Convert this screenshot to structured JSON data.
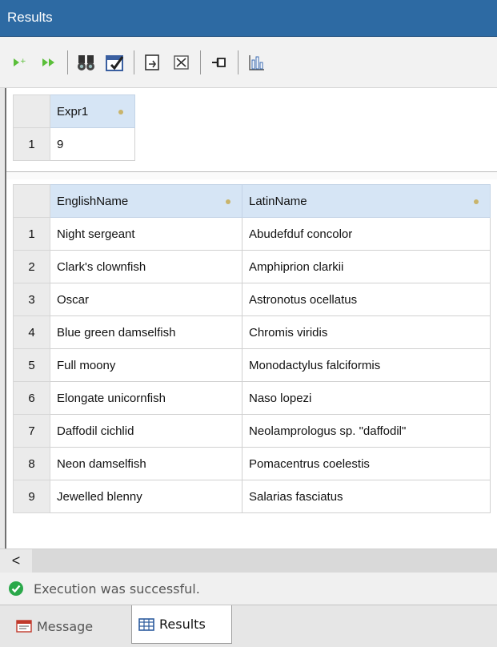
{
  "window": {
    "title": "Results"
  },
  "toolbar": {
    "icons": [
      "step-into-icon",
      "run-icon",
      "binoculars-find-icon",
      "checklist-icon",
      "export-icon",
      "fit-icon",
      "pin-icon",
      "chart-icon"
    ]
  },
  "grid1": {
    "columns": [
      "Expr1"
    ],
    "rows": [
      {
        "num": "1",
        "cells": [
          "9"
        ]
      }
    ]
  },
  "grid2": {
    "columns": [
      "EnglishName",
      "LatinName"
    ],
    "rows": [
      {
        "num": "1",
        "cells": [
          "Night sergeant",
          "Abudefduf concolor"
        ]
      },
      {
        "num": "2",
        "cells": [
          "Clark's clownfish",
          "Amphiprion clarkii"
        ]
      },
      {
        "num": "3",
        "cells": [
          "Oscar",
          "Astronotus ocellatus"
        ]
      },
      {
        "num": "4",
        "cells": [
          "Blue green damselfish",
          "Chromis viridis"
        ]
      },
      {
        "num": "5",
        "cells": [
          "Full moony",
          "Monodactylus falciformis"
        ]
      },
      {
        "num": "6",
        "cells": [
          "Elongate unicornfish",
          "Naso lopezi"
        ]
      },
      {
        "num": "7",
        "cells": [
          "Daffodil cichlid",
          "Neolamprologus sp. \"daffodil\""
        ]
      },
      {
        "num": "8",
        "cells": [
          "Neon damselfish",
          "Pomacentrus coelestis"
        ]
      },
      {
        "num": "9",
        "cells": [
          "Jewelled blenny",
          "Salarias fasciatus"
        ]
      }
    ]
  },
  "scrollbar": {
    "left_arrow": "<"
  },
  "status": {
    "text": "Execution was successful."
  },
  "tabs": [
    {
      "label": "Message",
      "active": false
    },
    {
      "label": "Results",
      "active": true
    }
  ],
  "colors": {
    "title_bar": "#2d6aa3",
    "header": "#d6e5f5",
    "success": "#2aa84a"
  }
}
